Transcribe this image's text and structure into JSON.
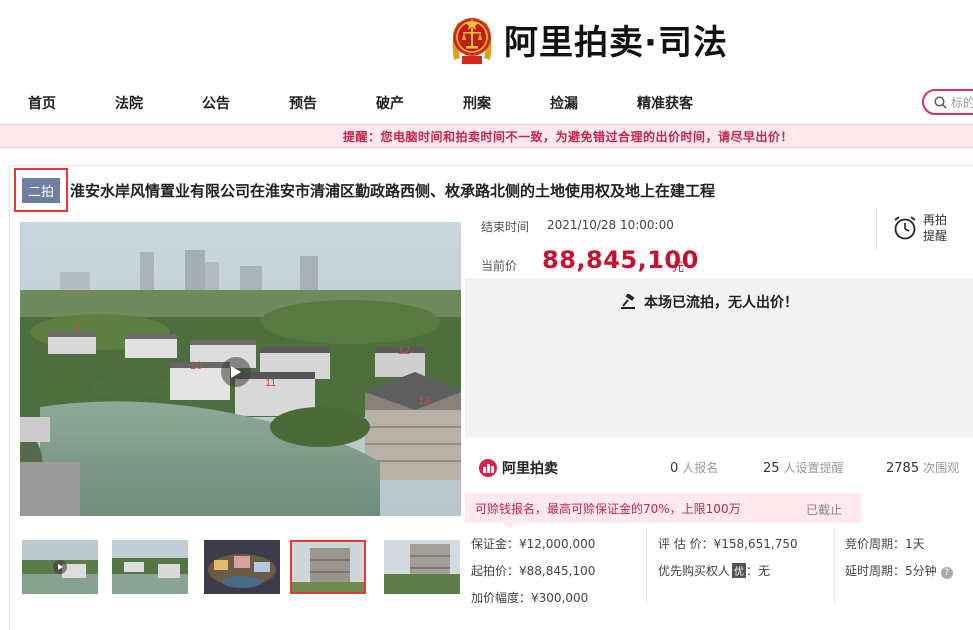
{
  "brand": {
    "logo_text": "阿里拍卖·司法",
    "ali_logo_text": "阿里拍卖"
  },
  "nav": {
    "items": [
      "首页",
      "法院",
      "公告",
      "预告",
      "破产",
      "刑案",
      "捡漏",
      "精准获客"
    ],
    "search_placeholder": "标的"
  },
  "warning": "提醒：您电脑时间和拍卖时间不一致，为避免错过合理的出价时间，请尽早出价！",
  "item": {
    "badge": "二拍",
    "title": "淮安水岸风情置业有限公司在淮安市清浦区勤政路西侧、枚承路北侧的土地使用权及地上在建工程",
    "end_time_label": "结束时间",
    "end_time": "2021/10/28 10:00:00",
    "price_label": "当前价",
    "price": "88,845,100",
    "price_unit": "元",
    "remind_label": "再拍提醒",
    "status_msg": "本场已流拍，无人出价！",
    "building_labels": [
      "5",
      "10",
      "11",
      "12",
      "13"
    ]
  },
  "stats": {
    "signups": "0",
    "signups_label": "人报名",
    "reminders": "25",
    "reminders_label": "人设置提醒",
    "views": "2785",
    "views_label": "次围观"
  },
  "deposit_bar": {
    "text": "可赊钱报名，最高可赊保证金的70%，上限100万",
    "end": "已截止"
  },
  "details": {
    "deposit": "保证金：¥12,000,000",
    "start_price": "起拍价：¥88,845,100",
    "increment": "加价幅度：¥300,000",
    "valuation": "评 估 价：¥158,651,750",
    "priority_label": "优先购买权人",
    "priority_badge": "优",
    "priority_value": "：无",
    "cycle": "竞价周期：1天",
    "delay": "延时周期：5分钟"
  },
  "colors": {
    "accent": "#c8102e",
    "warning_bg": "#ffe9ee",
    "badge_bg": "#6e7ea1",
    "highlight_border": "#e53935"
  }
}
